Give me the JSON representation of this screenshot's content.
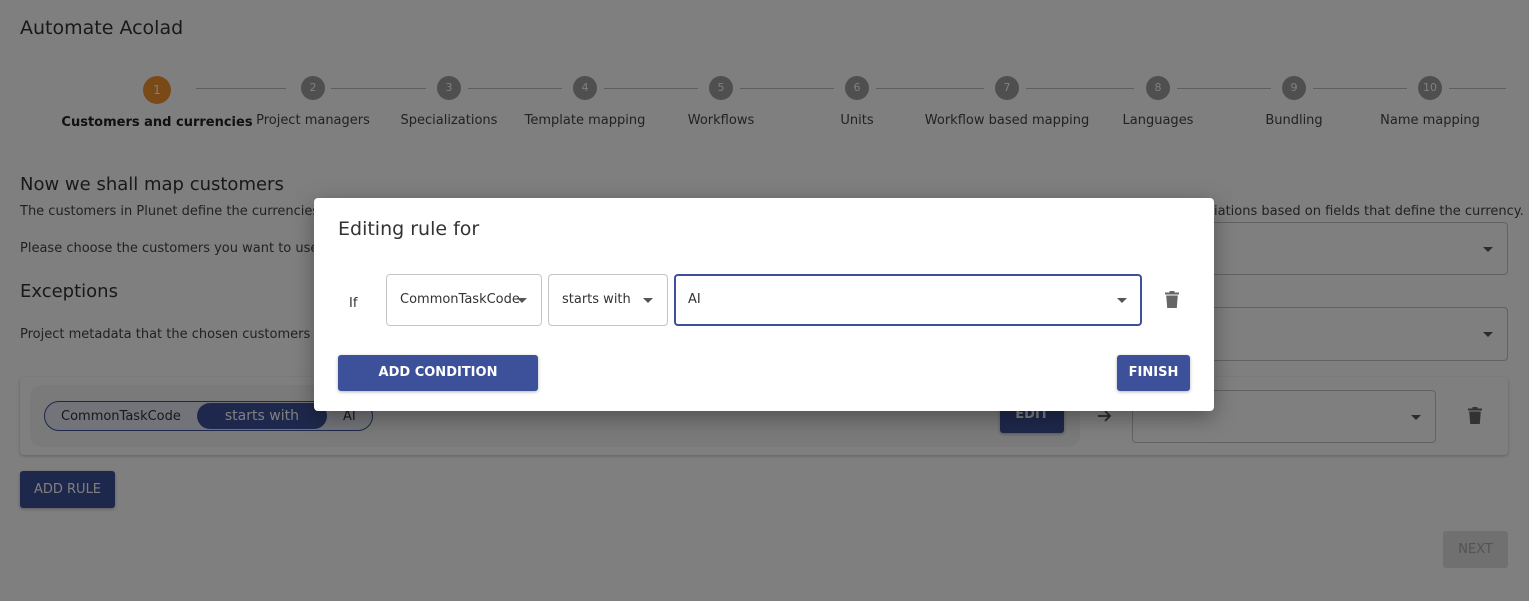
{
  "app": {
    "title": "Automate Acolad"
  },
  "stepper": {
    "steps": [
      {
        "number": "1",
        "label": "Customers and currencies",
        "active": true
      },
      {
        "number": "2",
        "label": "Project managers"
      },
      {
        "number": "3",
        "label": "Specializations"
      },
      {
        "number": "4",
        "label": "Template mapping"
      },
      {
        "number": "5",
        "label": "Workflows"
      },
      {
        "number": "6",
        "label": "Units"
      },
      {
        "number": "7",
        "label": "Workflow based mapping"
      },
      {
        "number": "8",
        "label": "Languages"
      },
      {
        "number": "9",
        "label": "Bundling"
      },
      {
        "number": "10",
        "label": "Name mapping"
      }
    ]
  },
  "customers_section": {
    "heading": "Now we shall map customers",
    "description_visible_left": "The customers in Plunet define the currencies as w",
    "description_visible_right": "iations based on fields that define the currency.",
    "instruction_visible": "Please choose the customers you want to use by de"
  },
  "exceptions_section": {
    "heading": "Exceptions",
    "description_visible": "Project metadata that the chosen customers depe"
  },
  "rule": {
    "field": "CommonTaskCode",
    "operator": "starts with",
    "value": "AI",
    "edit_label": "EDIT"
  },
  "buttons": {
    "add_rule": "ADD RULE",
    "next": "NEXT"
  },
  "modal": {
    "title": "Editing rule for",
    "if_label": "If",
    "condition": {
      "field": "CommonTaskCode",
      "operator": "starts with",
      "value": "AI"
    },
    "add_condition_label": "ADD CONDITION",
    "finish_label": "FINISH"
  },
  "colors": {
    "primary": "#3c5199",
    "active_step": "#f2952e",
    "inactive_step": "#9e9e9e"
  }
}
